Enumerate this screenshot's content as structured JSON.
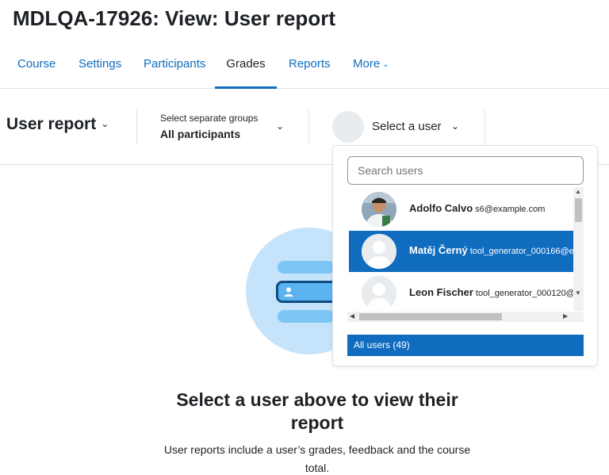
{
  "page_title": "MDLQA-17926: View: User report",
  "nav": {
    "items": [
      {
        "label": "Course"
      },
      {
        "label": "Settings"
      },
      {
        "label": "Participants"
      },
      {
        "label": "Grades",
        "active": true
      },
      {
        "label": "Reports"
      },
      {
        "label": "More"
      }
    ]
  },
  "toolbar": {
    "report_select": "User report",
    "groups_label": "Select separate groups",
    "groups_value": "All participants",
    "user_select_label": "Select a user"
  },
  "dropdown": {
    "search_placeholder": "Search users",
    "users": [
      {
        "name": "Adolfo Calvo",
        "email": "s6@example.com",
        "avatar": "photo"
      },
      {
        "name": "Matěj Černý",
        "email": "tool_generator_000166@e",
        "avatar": "default",
        "selected": true
      },
      {
        "name": "Leon Fischer",
        "email": "tool_generator_000120@",
        "avatar": "default"
      }
    ],
    "all_users": "All users (49)"
  },
  "empty_state": {
    "title": "Select a user above to view their report",
    "description": "User reports include a user’s grades, feedback and the course total."
  },
  "colors": {
    "accent": "#0f6cbf",
    "illustration_bg": "#c5e3fa"
  },
  "icons": [
    "chevron-down-icon",
    "person-icon",
    "scroll-up-icon",
    "scroll-down-icon",
    "scroll-left-icon",
    "scroll-right-icon"
  ]
}
